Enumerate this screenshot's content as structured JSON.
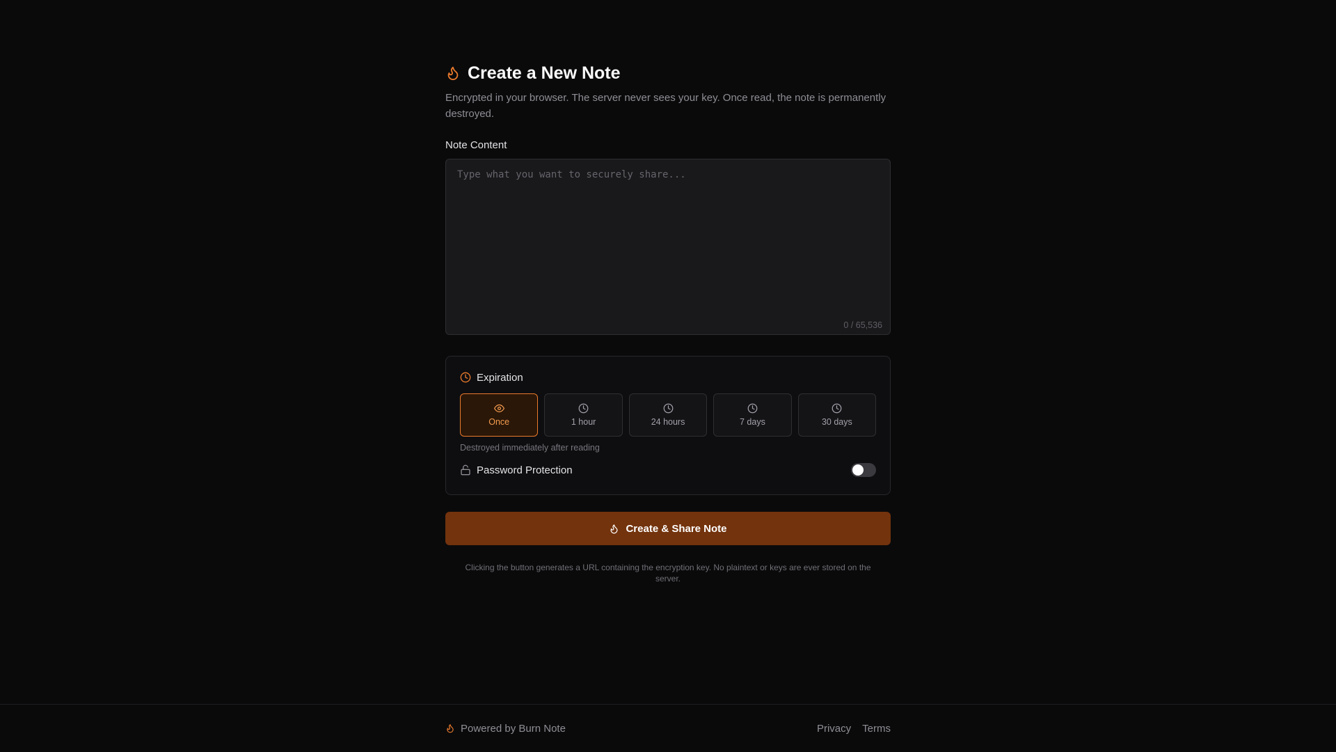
{
  "colors": {
    "accent": "#ea7a2c",
    "button_bg": "#73330d",
    "background": "#0a0a0b"
  },
  "header": {
    "title": "Create a New Note",
    "subtitle": "Encrypted in your browser. The server never sees your key. Once read, the note is permanently destroyed.",
    "icon": "flame-icon"
  },
  "note": {
    "label": "Note Content",
    "placeholder": "Type what you want to securely share...",
    "value": "",
    "char_count": "0 / 65,536"
  },
  "expiration": {
    "label": "Expiration",
    "icon": "clock-icon",
    "selected": "Once",
    "options": [
      {
        "label": "Once",
        "icon": "eye-icon",
        "active": true
      },
      {
        "label": "1 hour",
        "icon": "clock-icon",
        "active": false
      },
      {
        "label": "24 hours",
        "icon": "clock-icon",
        "active": false
      },
      {
        "label": "7 days",
        "icon": "clock-icon",
        "active": false
      },
      {
        "label": "30 days",
        "icon": "clock-icon",
        "active": false
      }
    ],
    "hint": "Destroyed immediately after reading"
  },
  "password": {
    "label": "Password Protection",
    "icon": "lock-icon",
    "enabled": false
  },
  "actions": {
    "create_label": "Create & Share Note",
    "create_icon": "flame-icon"
  },
  "fine_print": "Clicking the button generates a URL containing the encryption key. No plaintext or keys are ever stored on the server.",
  "footer": {
    "powered_by": "Powered by Burn Note",
    "links": [
      "Privacy",
      "Terms"
    ]
  }
}
